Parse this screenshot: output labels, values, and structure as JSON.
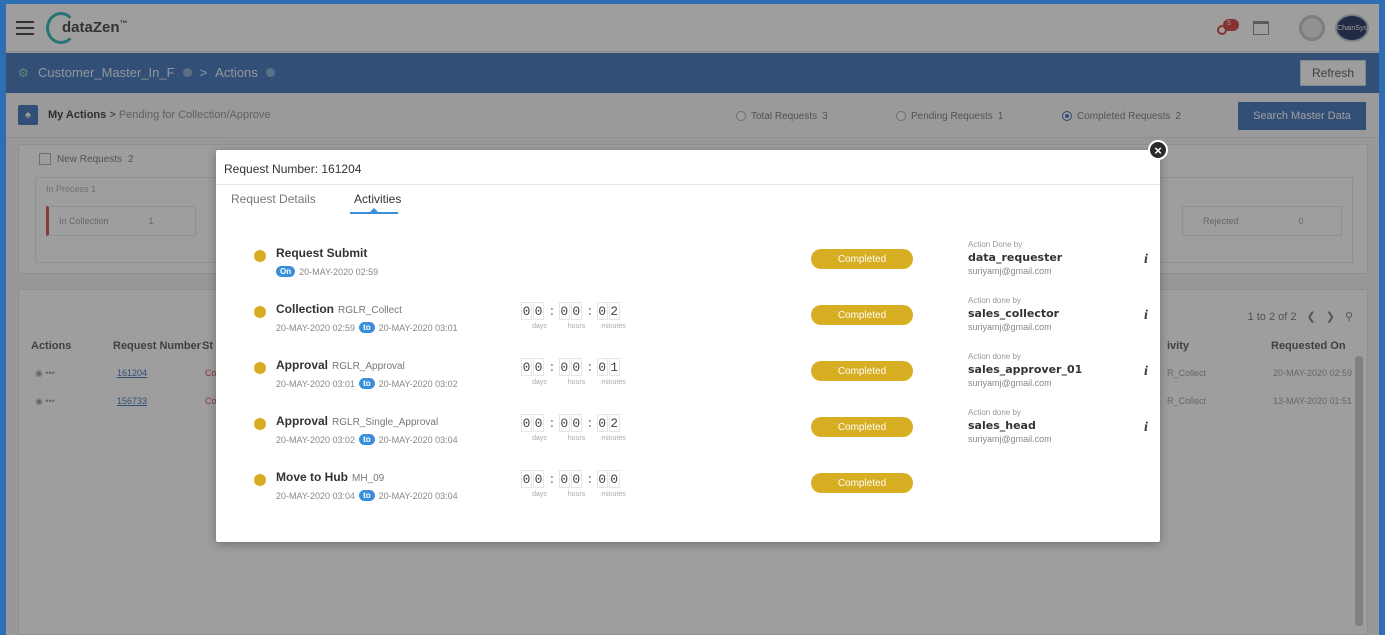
{
  "topbar": {
    "logo_text": "dataZen",
    "logo_tm": "™",
    "notification_count": "5",
    "brand_text": "ChainSys"
  },
  "breadcrumb": {
    "item1": "Customer_Master_In_F",
    "separator": ">",
    "item2": "Actions",
    "refresh_label": "Refresh"
  },
  "subheader": {
    "title": "My Actions",
    "arrow": ">",
    "subtitle": "Pending for Collection/Approve",
    "filters": [
      {
        "label": "Total Requests",
        "count": "3"
      },
      {
        "label": "Pending Requests",
        "count": "1"
      },
      {
        "label": "Completed Requests",
        "count": "2"
      }
    ],
    "search_button": "Search Master Data"
  },
  "panel": {
    "new_requests": "New Requests",
    "new_requests_count": "2",
    "in_process": "In Process",
    "in_process_count": "1",
    "in_collection": "In Collection",
    "in_collection_count": "1",
    "rejected": "Rejected",
    "rejected_count": "0"
  },
  "table": {
    "pager": "1 to 2 of 2",
    "headers": {
      "actions": "Actions",
      "request_number": "Request Number",
      "status": "St",
      "activity": "ivity",
      "requested_on": "Requested On"
    },
    "rows": [
      {
        "actions": "◉ •••",
        "request_number": "161204",
        "status": "Co",
        "activity": "R_Collect",
        "requested_on": "20-MAY-2020 02:59"
      },
      {
        "actions": "◉ •••",
        "request_number": "156733",
        "status": "Co",
        "activity": "R_Collect",
        "requested_on": "13-MAY-2020 01:51"
      }
    ]
  },
  "modal": {
    "title": "Request Number: 161204",
    "close_glyph": "×",
    "tabs": [
      "Request Details",
      "Activities"
    ],
    "timer_labels": [
      "days",
      "hours",
      "minutes"
    ],
    "to_pill": "to",
    "on_pill": "On",
    "activities": [
      {
        "name": "Request Submit",
        "sub": "",
        "date_from": "20-MAY-2020 02:59",
        "date_to": "",
        "timer": null,
        "status": "Completed",
        "done_label": "Action Done by",
        "done_user": "data_requester",
        "done_email": "suriyamj@gmail.com"
      },
      {
        "name": "Collection",
        "sub": "RGLR_Collect",
        "date_from": "20-MAY-2020 02:59",
        "date_to": "20-MAY-2020 03:01",
        "timer": {
          "days": "00",
          "hours": "00",
          "minutes": "02"
        },
        "status": "Completed",
        "done_label": "Action done by",
        "done_user": "sales_collector",
        "done_email": "suriyamj@gmail.com"
      },
      {
        "name": "Approval",
        "sub": "RGLR_Approval",
        "date_from": "20-MAY-2020 03:01",
        "date_to": "20-MAY-2020 03:02",
        "timer": {
          "days": "00",
          "hours": "00",
          "minutes": "01"
        },
        "status": "Completed",
        "done_label": "Action done by",
        "done_user": "sales_approver_01",
        "done_email": "suriyamj@gmail.com"
      },
      {
        "name": "Approval",
        "sub": "RGLR_Single_Approval",
        "date_from": "20-MAY-2020 03:02",
        "date_to": "20-MAY-2020 03:04",
        "timer": {
          "days": "00",
          "hours": "00",
          "minutes": "02"
        },
        "status": "Completed",
        "done_label": "Action done by",
        "done_user": "sales_head",
        "done_email": "suriyamj@gmail.com"
      },
      {
        "name": "Move to Hub",
        "sub": "MH_09",
        "date_from": "20-MAY-2020 03:04",
        "date_to": "20-MAY-2020 03:04",
        "timer": {
          "days": "00",
          "hours": "00",
          "minutes": "00"
        },
        "status": "Completed",
        "done_label": "",
        "done_user": "",
        "done_email": ""
      }
    ]
  }
}
